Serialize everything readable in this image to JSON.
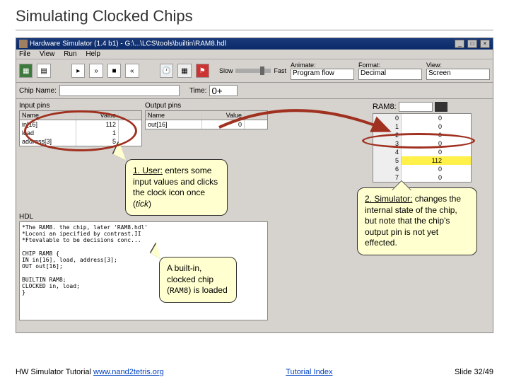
{
  "slide": {
    "title": "Simulating Clocked Chips",
    "footer_left": "HW Simulator Tutorial ",
    "footer_link1": "www.nand2tetris.org",
    "footer_mid": "Tutorial Index",
    "footer_right": "Slide 32/49"
  },
  "window": {
    "title": "Hardware Simulator (1.4 b1) - G:\\...\\LCS\\tools\\builtin\\RAM8.hdl",
    "menu": {
      "file": "File",
      "view": "View",
      "run": "Run",
      "help": "Help"
    }
  },
  "toolbar": {
    "speed_slow": "Slow",
    "speed_fast": "Fast",
    "animate_label": "Animate:",
    "animate_value": "Program flow",
    "format_label": "Format:",
    "format_value": "Decimal",
    "view_label": "View:",
    "view_value": "Screen"
  },
  "chipbar": {
    "chipname_label": "Chip Name:",
    "chipname_value": "",
    "time_label": "Time:",
    "time_value": "0+"
  },
  "panels": {
    "input_label": "Input pins",
    "output_label": "Output pins",
    "hdr_name": "Name",
    "hdr_value": "Value",
    "inputs": [
      {
        "name": "in[16]",
        "val": "112"
      },
      {
        "name": "load",
        "val": "1"
      },
      {
        "name": "address[3]",
        "val": "5"
      }
    ],
    "outputs": [
      {
        "name": "out[16]",
        "val": "0"
      }
    ],
    "ram_label": "RAM8:",
    "ram_rows": [
      {
        "i": "0",
        "v": "0"
      },
      {
        "i": "1",
        "v": "0"
      },
      {
        "i": "2",
        "v": "0"
      },
      {
        "i": "3",
        "v": "0"
      },
      {
        "i": "4",
        "v": "0"
      },
      {
        "i": "5",
        "v": "112"
      },
      {
        "i": "6",
        "v": "0"
      },
      {
        "i": "7",
        "v": "0"
      }
    ],
    "ram_highlight_index": 5,
    "hdl_label": "HDL",
    "hdl_text": "*The RAM8. the chip, later 'RAM8.hdl'\n*Loconi an ipecified by contrast.II\n*Ftevalable to be decisions conc...\n\nCHIP RAM8 {\n    IN in[16], load, address[3];\n    OUT out[16];\n\n    BUILTIN RAM8;\n    CLOCKED in, load;\n}"
  },
  "icons": {
    "chip": "chip-icon",
    "doc": "document-icon",
    "scroll": "scroll-icon",
    "clock": "clock-icon",
    "calc": "calculator-icon",
    "flag": "flag-icon"
  },
  "callouts": {
    "c1_prefix": "1. User:",
    "c1_body": " enters some input values and clicks the clock icon once (",
    "c1_suffix": "tick",
    "c1_end": ")",
    "c2_body": "A built-in, clocked chip (",
    "c2_chip": "RAM8",
    "c2_end": ") is loaded",
    "c3_prefix": "2. Simulator:",
    "c3_body": " changes the internal state of the chip, but note that the chip's output pin is not yet effected."
  }
}
